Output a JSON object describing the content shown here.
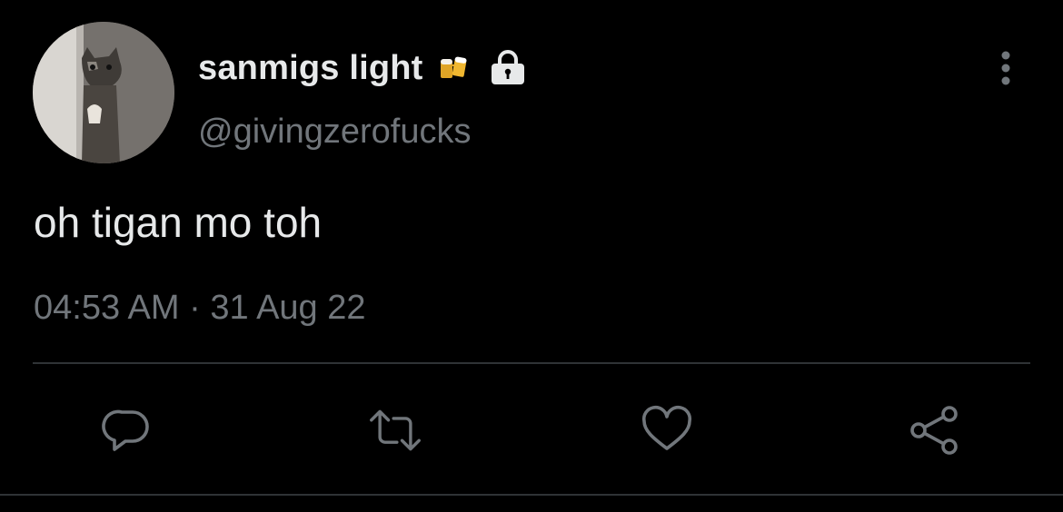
{
  "user": {
    "display_name": "sanmigs light",
    "handle": "@givingzerofucks",
    "avatar": "cat-peeking-avatar",
    "badges": [
      "beer-mugs-emoji",
      "lock-icon"
    ]
  },
  "tweet": {
    "text": "oh tigan mo toh",
    "time": "04:53 AM",
    "separator": "·",
    "date": "31 Aug 22"
  },
  "actions": {
    "reply": "reply-icon",
    "retweet": "retweet-icon",
    "like": "heart-icon",
    "share": "share-icon"
  },
  "colors": {
    "background": "#000000",
    "primary_text": "#e7e9ea",
    "secondary_text": "#71767b",
    "divider": "#2f3336"
  }
}
